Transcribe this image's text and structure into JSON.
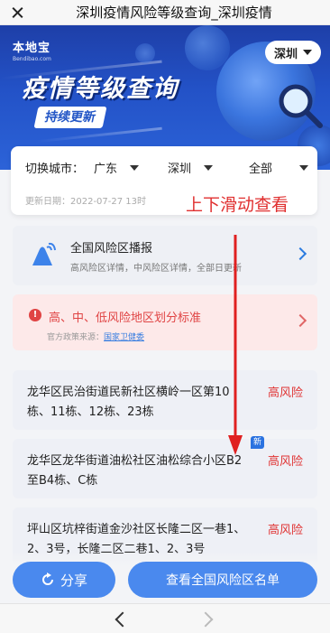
{
  "page_title": "深圳疫情风险等级查询_深圳疫情",
  "banner": {
    "logo_text": "本地宝",
    "logo_sub": "Bendibao.com",
    "title": "疫情等级查询",
    "subtitle": "持续更新",
    "city": "深圳"
  },
  "filter": {
    "label": "切换城市：",
    "province": "广东",
    "city": "深圳",
    "district": "全部",
    "update_time": "更新日期：2022-07-27 13时"
  },
  "scroll_hint": "上下滑动查看",
  "broadcast": {
    "title": "全国风险区播报",
    "desc": "高风险区详情，中风险区详情，全部日更新"
  },
  "standard": {
    "title": "高、中、低风险地区划分标准",
    "source_prefix": "官方政策来源：",
    "source_link": "国家卫健委"
  },
  "risk_areas": [
    {
      "text": "龙华区民治街道民新社区横岭一区第10栋、11栋、12栋、23栋",
      "level": "高风险",
      "is_new": false
    },
    {
      "text": "龙华区龙华街道油松社区油松综合小区B2至B4栋、C栋",
      "level": "高风险",
      "is_new": true,
      "tag": "新"
    },
    {
      "text": "坪山区坑梓街道金沙社区长隆二区一巷1、2、3号，长隆二区二巷1、2、3号",
      "level": "高风险",
      "is_new": false
    }
  ],
  "bottom": {
    "share_label": "分享",
    "list_label": "查看全国风险区名单"
  },
  "colors": {
    "accent": "#4a89ee",
    "danger": "#e03535",
    "banner": "#2352c7"
  }
}
